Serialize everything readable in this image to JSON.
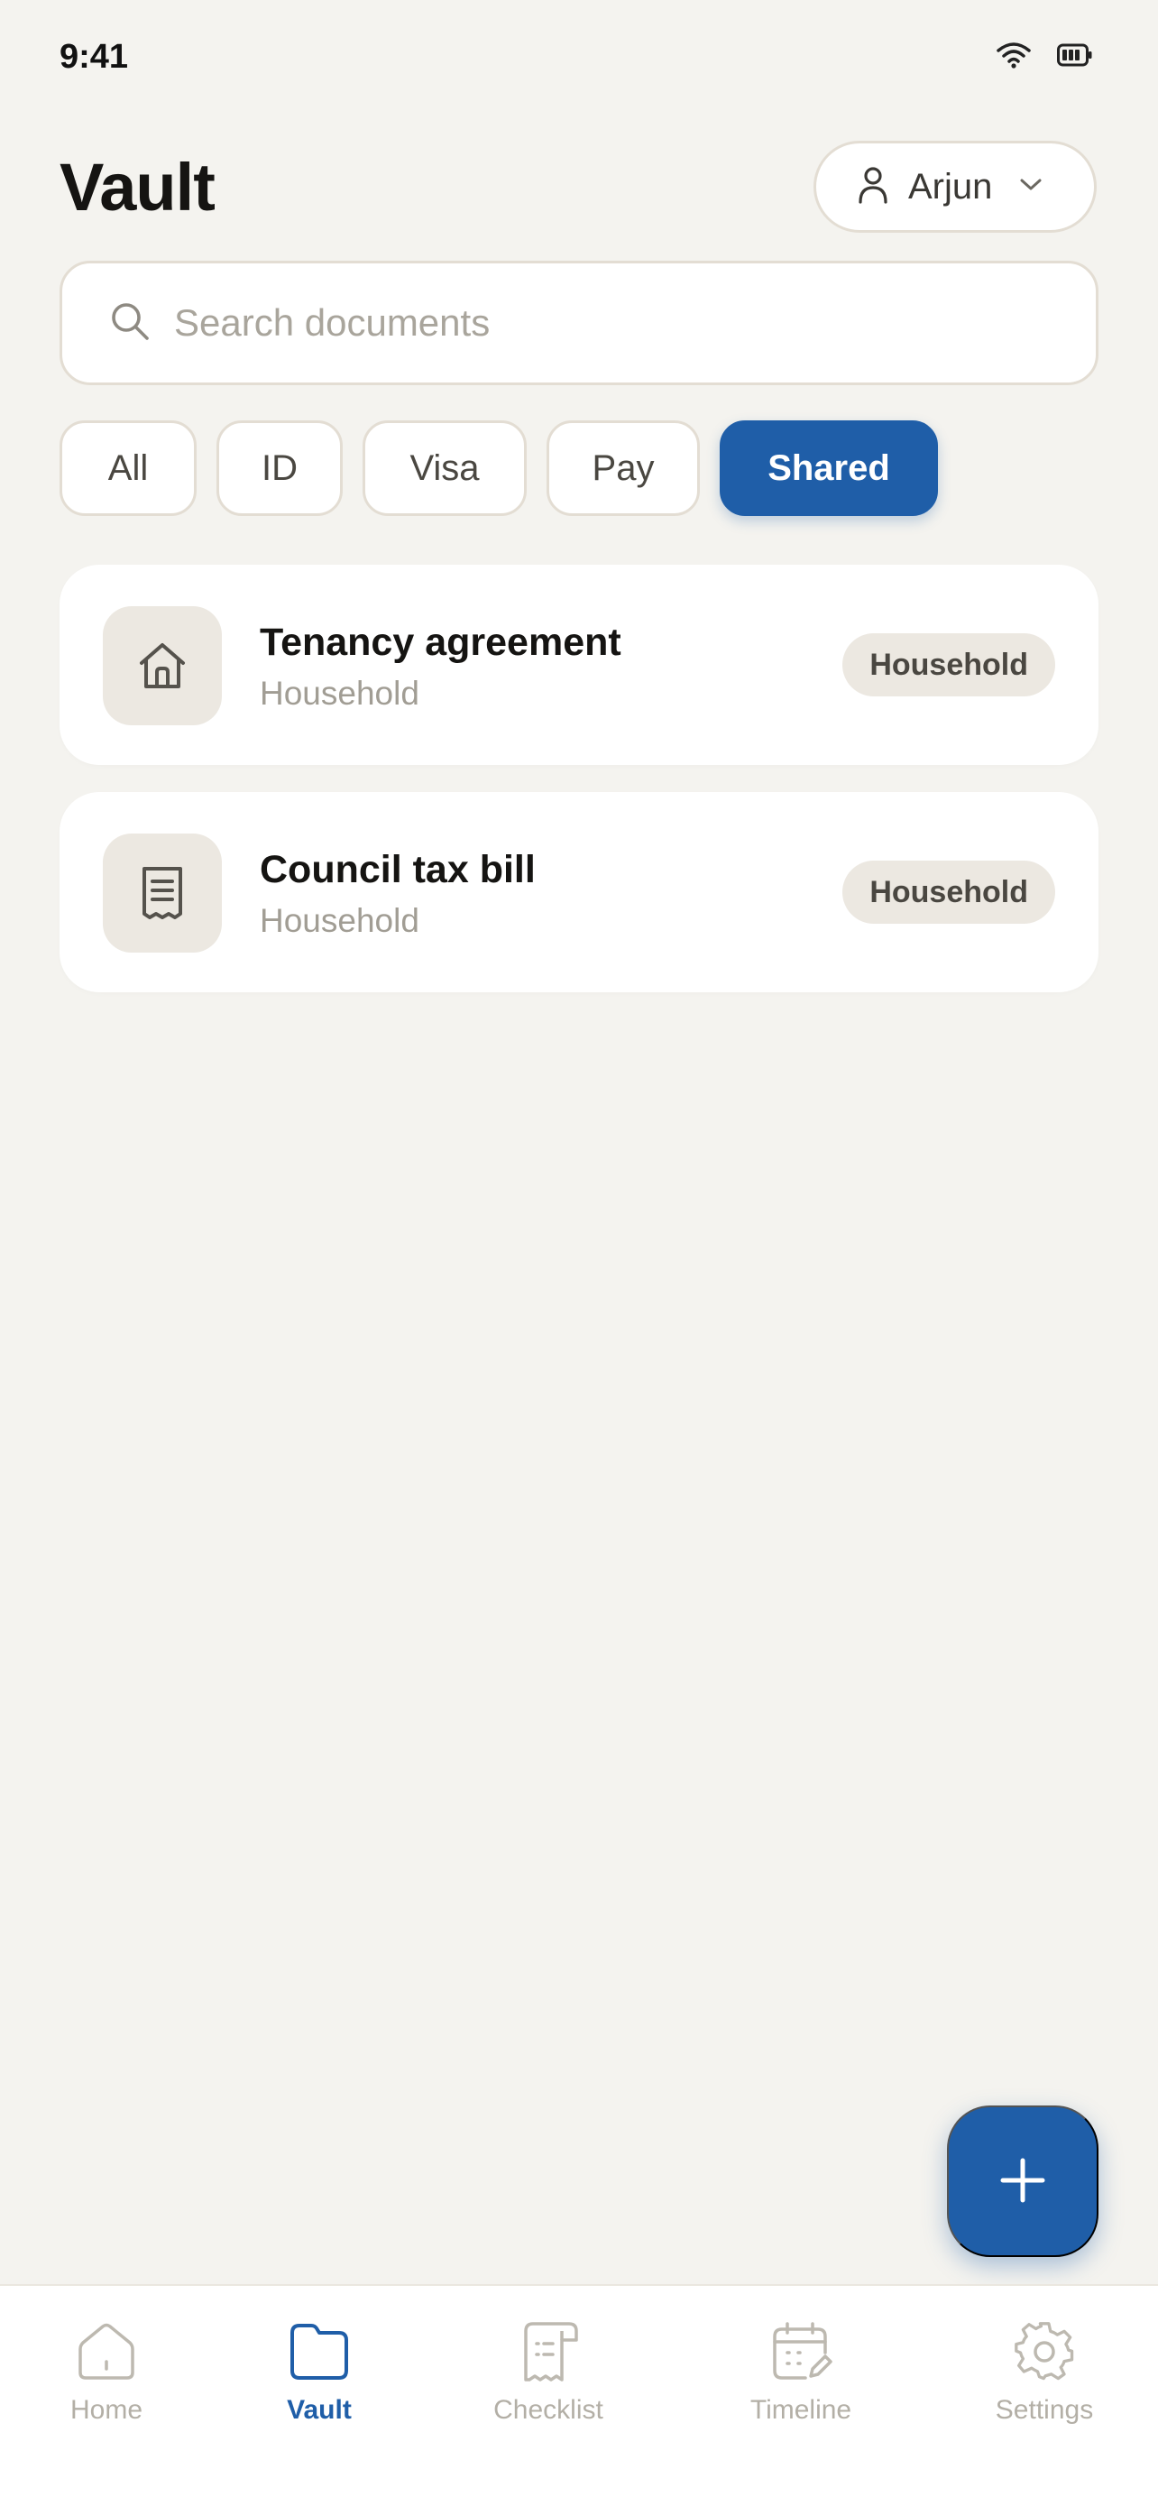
{
  "status_bar": {
    "time": "9:41",
    "icons": [
      "wifi-icon",
      "battery-icon"
    ]
  },
  "header": {
    "title": "Vault",
    "profile": {
      "name": "Arjun",
      "icon": "user-icon",
      "chevron": "chevron-down-icon"
    }
  },
  "search": {
    "placeholder": "Search documents",
    "value": "",
    "icon": "search-icon"
  },
  "filters": [
    {
      "label": "All",
      "active": false
    },
    {
      "label": "ID",
      "active": false
    },
    {
      "label": "Visa",
      "active": false
    },
    {
      "label": "Pay",
      "active": false
    },
    {
      "label": "Shared",
      "active": true
    }
  ],
  "documents": [
    {
      "title": "Tenancy agreement",
      "subtitle": "Household",
      "badge": "Household",
      "icon": "house-icon"
    },
    {
      "title": "Council tax bill",
      "subtitle": "Household",
      "badge": "Household",
      "icon": "receipt-icon"
    }
  ],
  "fab": {
    "icon": "plus-icon"
  },
  "nav": [
    {
      "label": "Home",
      "icon": "home-icon",
      "active": false
    },
    {
      "label": "Vault",
      "icon": "folder-icon",
      "active": true
    },
    {
      "label": "Checklist",
      "icon": "checklist-icon",
      "active": false
    },
    {
      "label": "Timeline",
      "icon": "calendar-icon",
      "active": false
    },
    {
      "label": "Settings",
      "icon": "gear-icon",
      "active": false
    }
  ],
  "colors": {
    "accent": "#1f5ea8",
    "background": "#f4f3ef",
    "card": "#ffffff",
    "muted": "#a19d94"
  }
}
